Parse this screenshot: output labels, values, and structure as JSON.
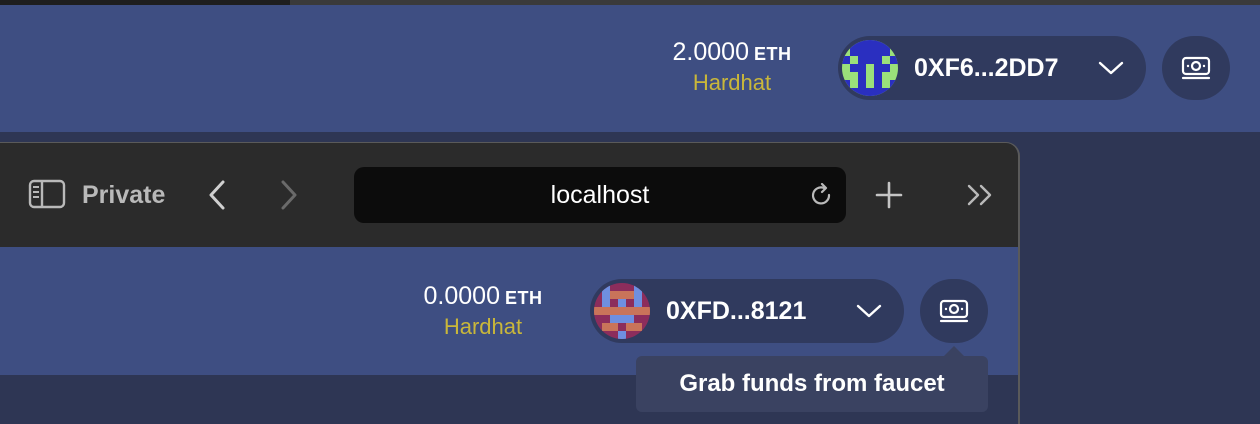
{
  "background_app": {
    "balance_amount": "2.0000",
    "balance_unit": "ETH",
    "network": "Hardhat",
    "address": "0XF6...2DD7",
    "icons": {
      "avatar": "identicon-avatar-icon",
      "dropdown": "chevron-down-icon",
      "faucet": "banknote-icon"
    }
  },
  "browser": {
    "private_label": "Private",
    "url": "localhost",
    "icons": {
      "sidebar": "sidebar-icon",
      "back": "chevron-left-icon",
      "forward": "chevron-right-icon",
      "reload": "reload-icon",
      "new_tab": "plus-icon",
      "more": "double-chevron-right-icon"
    }
  },
  "inner_app": {
    "balance_amount": "0.0000",
    "balance_unit": "ETH",
    "network": "Hardhat",
    "address": "0XFD...8121",
    "tooltip": "Grab funds from faucet",
    "icons": {
      "avatar": "identicon-avatar-icon",
      "dropdown": "chevron-down-icon",
      "faucet": "banknote-icon"
    }
  },
  "colors": {
    "header_blue": "#3e4e82",
    "pill": "#303a5e",
    "network_gold": "#c9b73a",
    "toolbar": "#2b2b2b",
    "urlbar": "#0c0c0c"
  }
}
